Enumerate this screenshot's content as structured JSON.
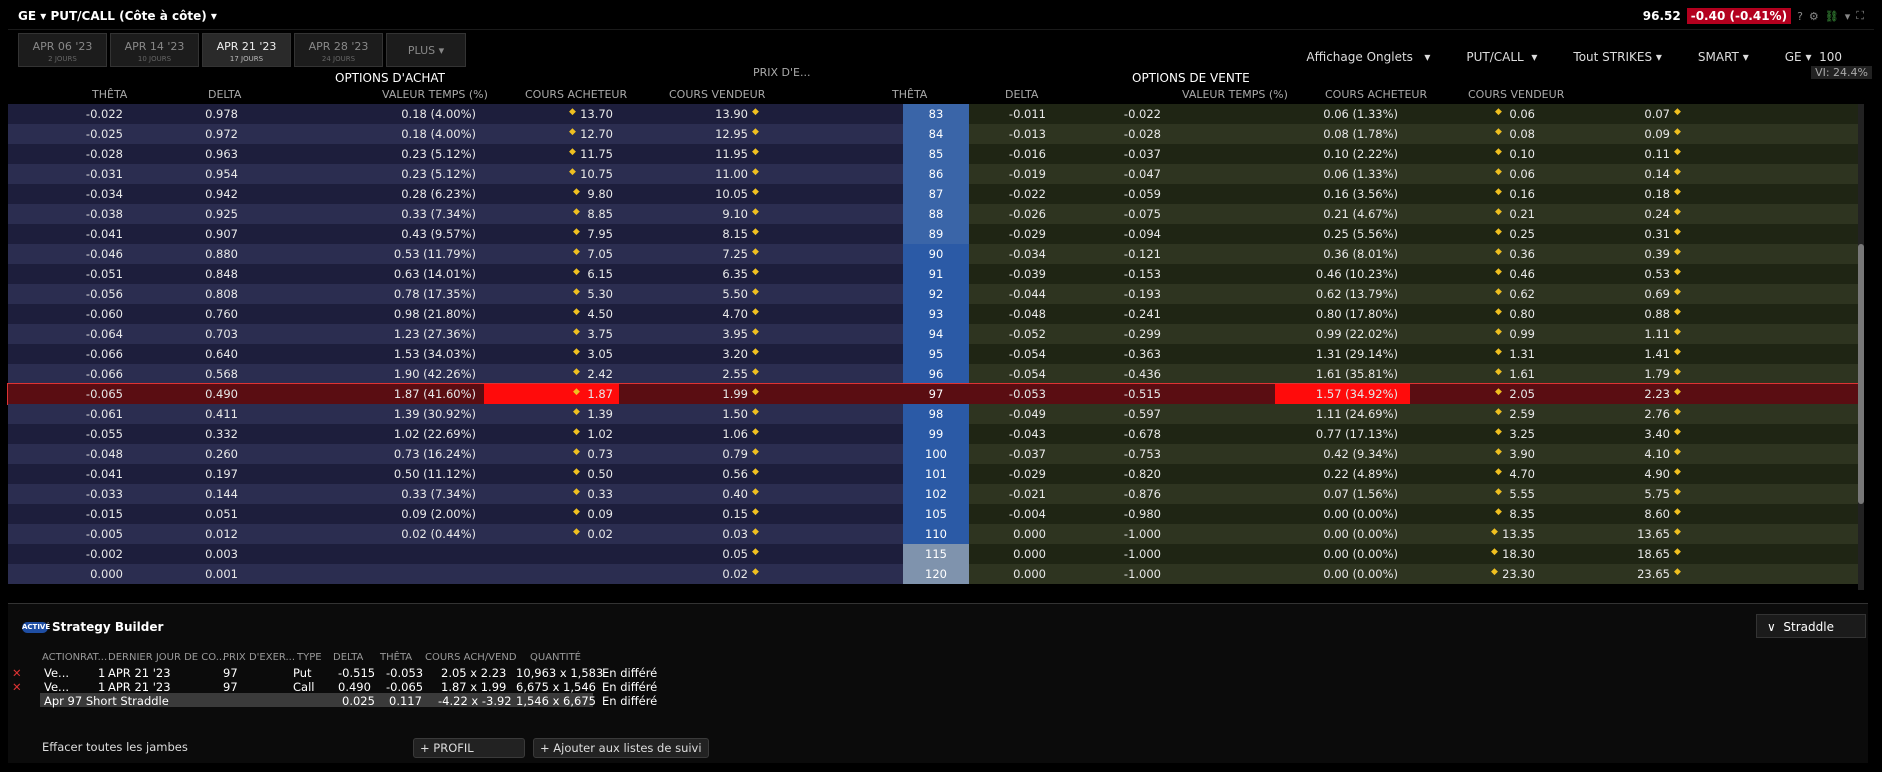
{
  "header": {
    "symbol": "GE",
    "title": "PUT/CALL (Côte à côte)",
    "price": "96.52",
    "change": "-0.40 (-0.41%)",
    "help": "?"
  },
  "tabs": [
    {
      "label": "APR 06 '23",
      "days": "2 JOURS"
    },
    {
      "label": "APR 14 '23",
      "days": "10 JOURS"
    },
    {
      "label": "APR 21 '23",
      "days": "17 JOURS"
    },
    {
      "label": "APR 28 '23",
      "days": "24 JOURS"
    },
    {
      "label": "PLUS"
    }
  ],
  "controls": {
    "affichage": "Affichage Onglets",
    "putcall": "PUT/CALL",
    "strikes": "Tout STRIKES",
    "exchange": "SMART",
    "symbol": "GE",
    "qty": "100",
    "vi": "VI: 24.4%"
  },
  "sections": {
    "calls": "OPTIONS D'ACHAT",
    "puts": "OPTIONS DE VENTE",
    "strike": "PRIX D'E..."
  },
  "columns": {
    "theta": "THÊTA",
    "delta": "DELTA",
    "timeval": "VALEUR TEMPS (%)",
    "bid": "COURS ACHETEUR",
    "ask": "COURS VENDEUR"
  },
  "rows": [
    {
      "ct": "-0.022",
      "cd": "0.978",
      "cv": "0.18 (4.00%)",
      "cb": "13.70",
      "ca": "13.90",
      "k": "83",
      "pt": "-0.011",
      "pd": "-0.022",
      "pv": "0.06 (1.33%)",
      "pb": "0.06",
      "pa": "0.07"
    },
    {
      "ct": "-0.025",
      "cd": "0.972",
      "cv": "0.18 (4.00%)",
      "cb": "12.70",
      "ca": "12.95",
      "k": "84",
      "pt": "-0.013",
      "pd": "-0.028",
      "pv": "0.08 (1.78%)",
      "pb": "0.08",
      "pa": "0.09"
    },
    {
      "ct": "-0.028",
      "cd": "0.963",
      "cv": "0.23 (5.12%)",
      "cb": "11.75",
      "ca": "11.95",
      "k": "85",
      "pt": "-0.016",
      "pd": "-0.037",
      "pv": "0.10 (2.22%)",
      "pb": "0.10",
      "pa": "0.11"
    },
    {
      "ct": "-0.031",
      "cd": "0.954",
      "cv": "0.23 (5.12%)",
      "cb": "10.75",
      "ca": "11.00",
      "k": "86",
      "pt": "-0.019",
      "pd": "-0.047",
      "pv": "0.06 (1.33%)",
      "pb": "0.06",
      "pa": "0.14"
    },
    {
      "ct": "-0.034",
      "cd": "0.942",
      "cv": "0.28 (6.23%)",
      "cb": "9.80",
      "ca": "10.05",
      "k": "87",
      "pt": "-0.022",
      "pd": "-0.059",
      "pv": "0.16 (3.56%)",
      "pb": "0.16",
      "pa": "0.18"
    },
    {
      "ct": "-0.038",
      "cd": "0.925",
      "cv": "0.33 (7.34%)",
      "cb": "8.85",
      "ca": "9.10",
      "k": "88",
      "pt": "-0.026",
      "pd": "-0.075",
      "pv": "0.21 (4.67%)",
      "pb": "0.21",
      "pa": "0.24"
    },
    {
      "ct": "-0.041",
      "cd": "0.907",
      "cv": "0.43 (9.57%)",
      "cb": "7.95",
      "ca": "8.15",
      "k": "89",
      "pt": "-0.029",
      "pd": "-0.094",
      "pv": "0.25 (5.56%)",
      "pb": "0.25",
      "pa": "0.31"
    },
    {
      "ct": "-0.046",
      "cd": "0.880",
      "cv": "0.53 (11.79%)",
      "cb": "7.05",
      "ca": "7.25",
      "k": "90",
      "pt": "-0.034",
      "pd": "-0.121",
      "pv": "0.36 (8.01%)",
      "pb": "0.36",
      "pa": "0.39"
    },
    {
      "ct": "-0.051",
      "cd": "0.848",
      "cv": "0.63 (14.01%)",
      "cb": "6.15",
      "ca": "6.35",
      "k": "91",
      "pt": "-0.039",
      "pd": "-0.153",
      "pv": "0.46 (10.23%)",
      "pb": "0.46",
      "pa": "0.53"
    },
    {
      "ct": "-0.056",
      "cd": "0.808",
      "cv": "0.78 (17.35%)",
      "cb": "5.30",
      "ca": "5.50",
      "k": "92",
      "pt": "-0.044",
      "pd": "-0.193",
      "pv": "0.62 (13.79%)",
      "pb": "0.62",
      "pa": "0.69"
    },
    {
      "ct": "-0.060",
      "cd": "0.760",
      "cv": "0.98 (21.80%)",
      "cb": "4.50",
      "ca": "4.70",
      "k": "93",
      "pt": "-0.048",
      "pd": "-0.241",
      "pv": "0.80 (17.80%)",
      "pb": "0.80",
      "pa": "0.88"
    },
    {
      "ct": "-0.064",
      "cd": "0.703",
      "cv": "1.23 (27.36%)",
      "cb": "3.75",
      "ca": "3.95",
      "k": "94",
      "pt": "-0.052",
      "pd": "-0.299",
      "pv": "0.99 (22.02%)",
      "pb": "0.99",
      "pa": "1.11"
    },
    {
      "ct": "-0.066",
      "cd": "0.640",
      "cv": "1.53 (34.03%)",
      "cb": "3.05",
      "ca": "3.20",
      "k": "95",
      "pt": "-0.054",
      "pd": "-0.363",
      "pv": "1.31 (29.14%)",
      "pb": "1.31",
      "pa": "1.41"
    },
    {
      "ct": "-0.066",
      "cd": "0.568",
      "cv": "1.90 (42.26%)",
      "cb": "2.42",
      "ca": "2.55",
      "k": "96",
      "pt": "-0.054",
      "pd": "-0.436",
      "pv": "1.61 (35.81%)",
      "pb": "1.61",
      "pa": "1.79"
    },
    {
      "ct": "-0.065",
      "cd": "0.490",
      "cv": "1.87 (41.60%)",
      "cb": "1.87",
      "ca": "1.99",
      "k": "97",
      "pt": "-0.053",
      "pd": "-0.515",
      "pv": "1.57 (34.92%)",
      "pb": "2.05",
      "pa": "2.23",
      "sel": true
    },
    {
      "ct": "-0.061",
      "cd": "0.411",
      "cv": "1.39 (30.92%)",
      "cb": "1.39",
      "ca": "1.50",
      "k": "98",
      "pt": "-0.049",
      "pd": "-0.597",
      "pv": "1.11 (24.69%)",
      "pb": "2.59",
      "pa": "2.76"
    },
    {
      "ct": "-0.055",
      "cd": "0.332",
      "cv": "1.02 (22.69%)",
      "cb": "1.02",
      "ca": "1.06",
      "k": "99",
      "pt": "-0.043",
      "pd": "-0.678",
      "pv": "0.77 (17.13%)",
      "pb": "3.25",
      "pa": "3.40"
    },
    {
      "ct": "-0.048",
      "cd": "0.260",
      "cv": "0.73 (16.24%)",
      "cb": "0.73",
      "ca": "0.79",
      "k": "100",
      "pt": "-0.037",
      "pd": "-0.753",
      "pv": "0.42 (9.34%)",
      "pb": "3.90",
      "pa": "4.10"
    },
    {
      "ct": "-0.041",
      "cd": "0.197",
      "cv": "0.50 (11.12%)",
      "cb": "0.50",
      "ca": "0.56",
      "k": "101",
      "pt": "-0.029",
      "pd": "-0.820",
      "pv": "0.22 (4.89%)",
      "pb": "4.70",
      "pa": "4.90"
    },
    {
      "ct": "-0.033",
      "cd": "0.144",
      "cv": "0.33 (7.34%)",
      "cb": "0.33",
      "ca": "0.40",
      "k": "102",
      "pt": "-0.021",
      "pd": "-0.876",
      "pv": "0.07 (1.56%)",
      "pb": "5.55",
      "pa": "5.75"
    },
    {
      "ct": "-0.015",
      "cd": "0.051",
      "cv": "0.09 (2.00%)",
      "cb": "0.09",
      "ca": "0.15",
      "k": "105",
      "pt": "-0.004",
      "pd": "-0.980",
      "pv": "0.00 (0.00%)",
      "pb": "8.35",
      "pa": "8.60"
    },
    {
      "ct": "-0.005",
      "cd": "0.012",
      "cv": "0.02 (0.44%)",
      "cb": "0.02",
      "ca": "0.03",
      "k": "110",
      "pt": "0.000",
      "pd": "-1.000",
      "pv": "0.00 (0.00%)",
      "pb": "13.35",
      "pa": "13.65"
    },
    {
      "ct": "-0.002",
      "cd": "0.003",
      "cv": "",
      "cb": "",
      "ca": "0.05",
      "k": "115",
      "pt": "0.000",
      "pd": "-1.000",
      "pv": "0.00 (0.00%)",
      "pb": "18.30",
      "pa": "18.65"
    },
    {
      "ct": "0.000",
      "cd": "0.001",
      "cv": "",
      "cb": "",
      "ca": "0.02",
      "k": "120",
      "pt": "0.000",
      "pd": "-1.000",
      "pv": "0.00 (0.00%)",
      "pb": "23.30",
      "pa": "23.65"
    }
  ],
  "strategy": {
    "toggle": "ACTIVÉ",
    "title": "Strategy Builder",
    "dropdown": "Straddle",
    "headers": [
      "ACTIONRAT...",
      "DERNIER JOUR DE CO...",
      "PRIX D'EXER...",
      "TYPE",
      "DELTA",
      "THÊTA",
      "COURS ACH/VEND",
      "QUANTITÉ"
    ],
    "legs": [
      {
        "action": "Ve...",
        "ratio": "1",
        "date": "APR 21 '23",
        "strike": "97",
        "type": "Put",
        "delta": "-0.515",
        "theta": "-0.053",
        "quote": "2.05 x 2.23",
        "qty": "10,963 x 1,583",
        "status": "En différé"
      },
      {
        "action": "Ve...",
        "ratio": "1",
        "date": "APR 21 '23",
        "strike": "97",
        "type": "Call",
        "delta": "0.490",
        "theta": "-0.065",
        "quote": "1.87 x 1.99",
        "qty": "6,675 x 1,546",
        "status": "En différé"
      }
    ],
    "summary": {
      "name": "Apr 97 Short Straddle",
      "delta": "0.025",
      "theta": "0.117",
      "quote": "-4.22 x -3.92",
      "qty": "1,546 x 6,675",
      "status": "En différé"
    },
    "clear": "Effacer toutes les jambes",
    "profile": "+ PROFIL",
    "watch": "+ Ajouter aux listes de suivi"
  }
}
